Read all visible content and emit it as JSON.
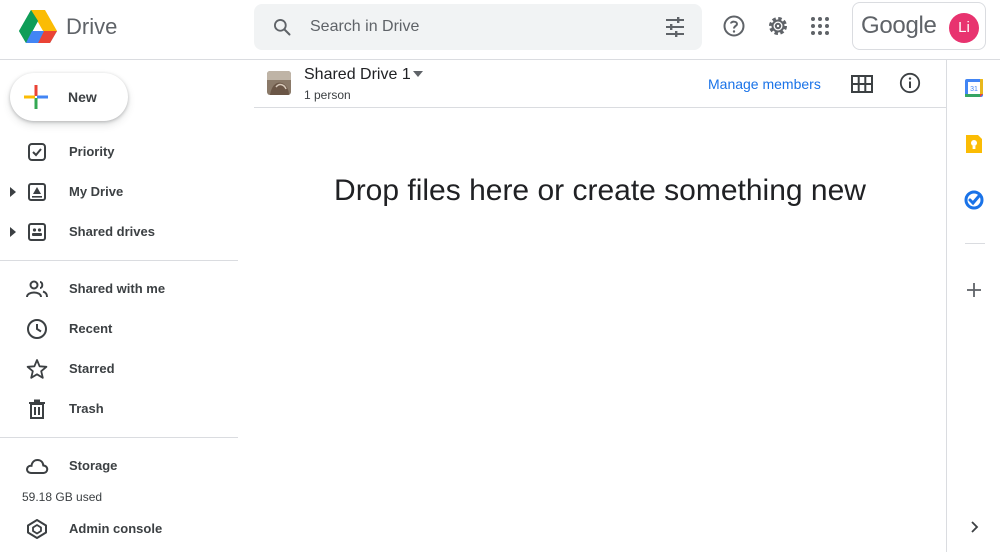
{
  "header": {
    "app_name": "Drive",
    "search_placeholder": "Search in Drive",
    "account_brand": "Google",
    "avatar_initials": "Li"
  },
  "sidebar": {
    "new_label": "New",
    "items": [
      {
        "label": "Priority",
        "icon": "priority-icon"
      },
      {
        "label": "My Drive",
        "icon": "my-drive-icon"
      },
      {
        "label": "Shared drives",
        "icon": "shared-drives-icon"
      },
      {
        "label": "Shared with me",
        "icon": "people-icon"
      },
      {
        "label": "Recent",
        "icon": "clock-icon"
      },
      {
        "label": "Starred",
        "icon": "star-icon"
      },
      {
        "label": "Trash",
        "icon": "trash-icon"
      },
      {
        "label": "Storage",
        "icon": "cloud-icon"
      },
      {
        "label": "Admin console",
        "icon": "admin-icon"
      }
    ],
    "storage_used": "59.18 GB used"
  },
  "main": {
    "drive_name": "Shared Drive 1",
    "drive_members": "1 person",
    "manage_members": "Manage members",
    "empty_message": "Drop files here or create something new"
  },
  "side_panel": {
    "calendar_day": "31",
    "apps": [
      "calendar-icon",
      "keep-icon",
      "tasks-icon",
      "add-icon"
    ]
  },
  "colors": {
    "accent": "#1a73e8",
    "avatar": "#e8336f",
    "keep": "#fbbc04"
  }
}
